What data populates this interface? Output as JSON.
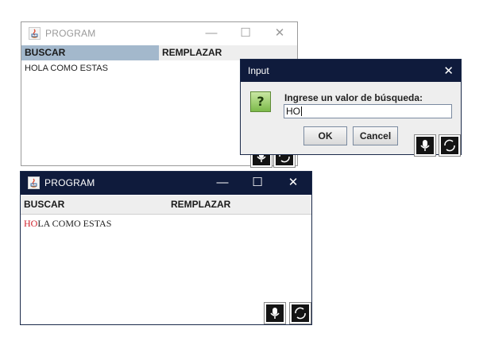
{
  "window_back": {
    "title": "PROGRAM",
    "tabs": [
      "BUSCAR",
      "REMPLAZAR"
    ],
    "text": "HOLA COMO ESTAS",
    "controls": {
      "minimize": "—",
      "maximize": "☐",
      "close": "✕"
    }
  },
  "dialog": {
    "title": "Input",
    "close": "✕",
    "icon_glyph": "?",
    "prompt": "Ingrese un valor de búsqueda:",
    "input_value": "HO",
    "ok_label": "OK",
    "cancel_label": "Cancel"
  },
  "window_front": {
    "title": "PROGRAM",
    "tabs": [
      "BUSCAR",
      "REMPLAZAR"
    ],
    "text_highlight": "HO",
    "text_rest": "LA COMO ESTAS",
    "controls": {
      "minimize": "—",
      "maximize": "☐",
      "close": "✕"
    }
  },
  "colors": {
    "titlebar_active": "#0f1b3c",
    "tab_selected": "#a3b8cc",
    "highlight": "#d0202a"
  },
  "icons": [
    "java-app-icon",
    "microphone-icon",
    "refresh-icon",
    "question-icon"
  ]
}
